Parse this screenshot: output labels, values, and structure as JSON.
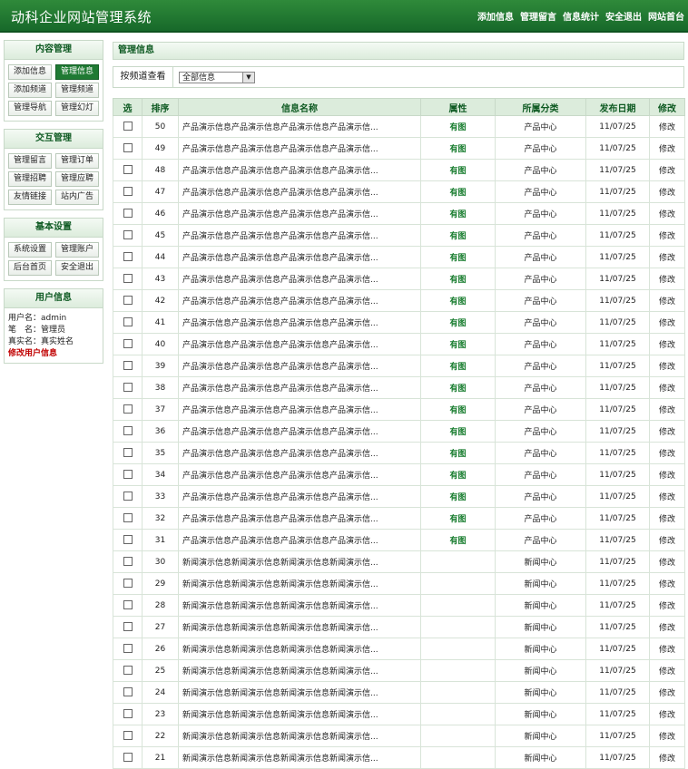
{
  "header": {
    "title": "动科企业网站管理系统",
    "nav": [
      "添加信息",
      "管理留言",
      "信息统计",
      "安全退出",
      "网站首台"
    ]
  },
  "sidebar": {
    "sections": [
      {
        "title": "内容管理",
        "buttons": [
          "添加信息",
          "管理信息",
          "添加频道",
          "管理频道",
          "管理导航",
          "管理幻灯"
        ],
        "active": 1
      },
      {
        "title": "交互管理",
        "buttons": [
          "管理留言",
          "管理订单",
          "管理招聘",
          "管理应聘",
          "友情链接",
          "站内广告"
        ]
      },
      {
        "title": "基本设置",
        "buttons": [
          "系统设置",
          "管理账户",
          "后台首页",
          "安全退出"
        ]
      }
    ],
    "user": {
      "title": "用户信息",
      "lines": [
        "用户名：admin",
        "笔　名：管理员",
        "真实名：真实姓名"
      ],
      "edit_link": "修改用户信息"
    }
  },
  "main": {
    "title": "管理信息",
    "filter": {
      "label": "按频道查看",
      "selected": "全部信息"
    },
    "table": {
      "headers": [
        "选",
        "排序",
        "信息名称",
        "属性",
        "所属分类",
        "发布日期",
        "修改"
      ],
      "rows": [
        {
          "order": "50",
          "name": "产品演示信息产品演示信息产品演示信息产品演示信...",
          "attr": "有图",
          "category": "产品中心",
          "date": "11/07/25",
          "action": "修改"
        },
        {
          "order": "49",
          "name": "产品演示信息产品演示信息产品演示信息产品演示信...",
          "attr": "有图",
          "category": "产品中心",
          "date": "11/07/25",
          "action": "修改"
        },
        {
          "order": "48",
          "name": "产品演示信息产品演示信息产品演示信息产品演示信...",
          "attr": "有图",
          "category": "产品中心",
          "date": "11/07/25",
          "action": "修改"
        },
        {
          "order": "47",
          "name": "产品演示信息产品演示信息产品演示信息产品演示信...",
          "attr": "有图",
          "category": "产品中心",
          "date": "11/07/25",
          "action": "修改"
        },
        {
          "order": "46",
          "name": "产品演示信息产品演示信息产品演示信息产品演示信...",
          "attr": "有图",
          "category": "产品中心",
          "date": "11/07/25",
          "action": "修改"
        },
        {
          "order": "45",
          "name": "产品演示信息产品演示信息产品演示信息产品演示信...",
          "attr": "有图",
          "category": "产品中心",
          "date": "11/07/25",
          "action": "修改"
        },
        {
          "order": "44",
          "name": "产品演示信息产品演示信息产品演示信息产品演示信...",
          "attr": "有图",
          "category": "产品中心",
          "date": "11/07/25",
          "action": "修改"
        },
        {
          "order": "43",
          "name": "产品演示信息产品演示信息产品演示信息产品演示信...",
          "attr": "有图",
          "category": "产品中心",
          "date": "11/07/25",
          "action": "修改"
        },
        {
          "order": "42",
          "name": "产品演示信息产品演示信息产品演示信息产品演示信...",
          "attr": "有图",
          "category": "产品中心",
          "date": "11/07/25",
          "action": "修改"
        },
        {
          "order": "41",
          "name": "产品演示信息产品演示信息产品演示信息产品演示信...",
          "attr": "有图",
          "category": "产品中心",
          "date": "11/07/25",
          "action": "修改"
        },
        {
          "order": "40",
          "name": "产品演示信息产品演示信息产品演示信息产品演示信...",
          "attr": "有图",
          "category": "产品中心",
          "date": "11/07/25",
          "action": "修改"
        },
        {
          "order": "39",
          "name": "产品演示信息产品演示信息产品演示信息产品演示信...",
          "attr": "有图",
          "category": "产品中心",
          "date": "11/07/25",
          "action": "修改"
        },
        {
          "order": "38",
          "name": "产品演示信息产品演示信息产品演示信息产品演示信...",
          "attr": "有图",
          "category": "产品中心",
          "date": "11/07/25",
          "action": "修改"
        },
        {
          "order": "37",
          "name": "产品演示信息产品演示信息产品演示信息产品演示信...",
          "attr": "有图",
          "category": "产品中心",
          "date": "11/07/25",
          "action": "修改"
        },
        {
          "order": "36",
          "name": "产品演示信息产品演示信息产品演示信息产品演示信...",
          "attr": "有图",
          "category": "产品中心",
          "date": "11/07/25",
          "action": "修改"
        },
        {
          "order": "35",
          "name": "产品演示信息产品演示信息产品演示信息产品演示信...",
          "attr": "有图",
          "category": "产品中心",
          "date": "11/07/25",
          "action": "修改"
        },
        {
          "order": "34",
          "name": "产品演示信息产品演示信息产品演示信息产品演示信...",
          "attr": "有图",
          "category": "产品中心",
          "date": "11/07/25",
          "action": "修改"
        },
        {
          "order": "33",
          "name": "产品演示信息产品演示信息产品演示信息产品演示信...",
          "attr": "有图",
          "category": "产品中心",
          "date": "11/07/25",
          "action": "修改"
        },
        {
          "order": "32",
          "name": "产品演示信息产品演示信息产品演示信息产品演示信...",
          "attr": "有图",
          "category": "产品中心",
          "date": "11/07/25",
          "action": "修改"
        },
        {
          "order": "31",
          "name": "产品演示信息产品演示信息产品演示信息产品演示信...",
          "attr": "有图",
          "category": "产品中心",
          "date": "11/07/25",
          "action": "修改"
        },
        {
          "order": "30",
          "name": "新闻演示信息新闻演示信息新闻演示信息新闻演示信...",
          "attr": "",
          "category": "新闻中心",
          "date": "11/07/25",
          "action": "修改"
        },
        {
          "order": "29",
          "name": "新闻演示信息新闻演示信息新闻演示信息新闻演示信...",
          "attr": "",
          "category": "新闻中心",
          "date": "11/07/25",
          "action": "修改"
        },
        {
          "order": "28",
          "name": "新闻演示信息新闻演示信息新闻演示信息新闻演示信...",
          "attr": "",
          "category": "新闻中心",
          "date": "11/07/25",
          "action": "修改"
        },
        {
          "order": "27",
          "name": "新闻演示信息新闻演示信息新闻演示信息新闻演示信...",
          "attr": "",
          "category": "新闻中心",
          "date": "11/07/25",
          "action": "修改"
        },
        {
          "order": "26",
          "name": "新闻演示信息新闻演示信息新闻演示信息新闻演示信...",
          "attr": "",
          "category": "新闻中心",
          "date": "11/07/25",
          "action": "修改"
        },
        {
          "order": "25",
          "name": "新闻演示信息新闻演示信息新闻演示信息新闻演示信...",
          "attr": "",
          "category": "新闻中心",
          "date": "11/07/25",
          "action": "修改"
        },
        {
          "order": "24",
          "name": "新闻演示信息新闻演示信息新闻演示信息新闻演示信...",
          "attr": "",
          "category": "新闻中心",
          "date": "11/07/25",
          "action": "修改"
        },
        {
          "order": "23",
          "name": "新闻演示信息新闻演示信息新闻演示信息新闻演示信...",
          "attr": "",
          "category": "新闻中心",
          "date": "11/07/25",
          "action": "修改"
        },
        {
          "order": "22",
          "name": "新闻演示信息新闻演示信息新闻演示信息新闻演示信...",
          "attr": "",
          "category": "新闻中心",
          "date": "11/07/25",
          "action": "修改"
        },
        {
          "order": "21",
          "name": "新闻演示信息新闻演示信息新闻演示信息新闻演示信...",
          "attr": "",
          "category": "新闻中心",
          "date": "11/07/25",
          "action": "修改"
        }
      ]
    }
  }
}
